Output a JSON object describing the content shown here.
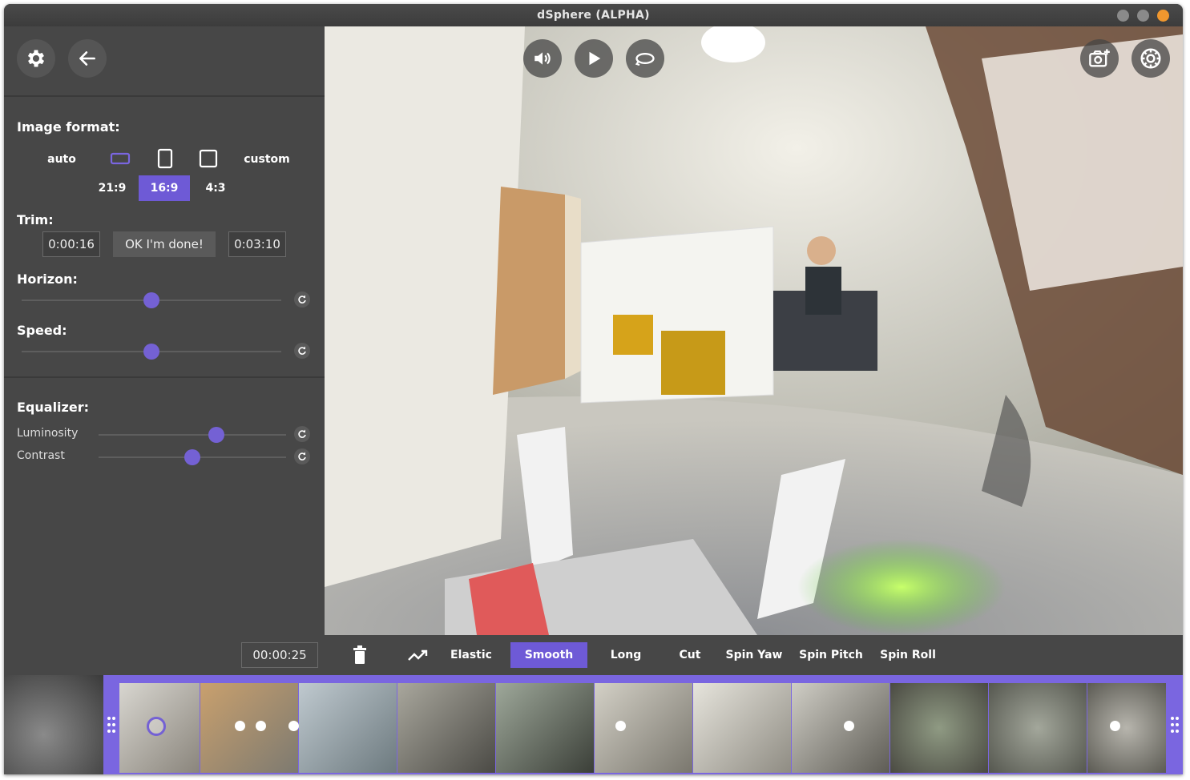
{
  "window": {
    "title": "dSphere  (ALPHA)"
  },
  "sidebar": {
    "image_format_label": "Image format:",
    "format_options": {
      "auto": "auto",
      "custom": "custom"
    },
    "ratios": [
      "21:9",
      "16:9",
      "4:3"
    ],
    "selected_ratio": "16:9",
    "trim_label": "Trim:",
    "trim_start": "0:00:16",
    "trim_done_label": "OK I'm done!",
    "trim_end": "0:03:10",
    "horizon_label": "Horizon:",
    "horizon_value": 0.5,
    "speed_label": "Speed:",
    "speed_value": 0.5,
    "equalizer_label": "Equalizer:",
    "luminosity_label": "Luminosity",
    "luminosity_value": 0.63,
    "contrast_label": "Contrast",
    "contrast_value": 0.5
  },
  "player": {
    "icons": [
      "volume-icon",
      "play-icon",
      "loop-icon",
      "camera-add-icon",
      "settings-icon"
    ]
  },
  "controlbar": {
    "time": "00:00:25",
    "modes": [
      "Elastic",
      "Smooth",
      "Long",
      "Cut",
      "Spin Yaw",
      "Spin Pitch",
      "Spin Roll"
    ],
    "selected_mode": "Smooth"
  },
  "colors": {
    "accent": "#6e5ad6",
    "panel": "#474747",
    "titlebar": "#3c3c3c",
    "close": "#f0972e"
  }
}
